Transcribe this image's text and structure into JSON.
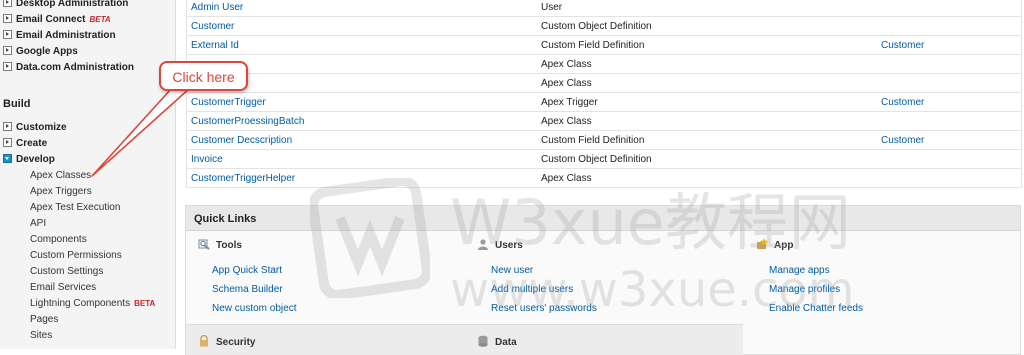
{
  "sidebar": {
    "admin_items": [
      {
        "label": "Desktop Administration",
        "beta": ""
      },
      {
        "label": "Email Connect",
        "beta": "BETA"
      },
      {
        "label": "Email Administration",
        "beta": ""
      },
      {
        "label": "Google Apps",
        "beta": ""
      },
      {
        "label": "Data.com Administration",
        "beta": ""
      }
    ],
    "build_heading": "Build",
    "build_items": [
      {
        "label": "Customize"
      },
      {
        "label": "Create"
      },
      {
        "label": "Develop"
      }
    ],
    "develop_items": [
      {
        "label": "Apex Classes",
        "beta": ""
      },
      {
        "label": "Apex Triggers",
        "beta": ""
      },
      {
        "label": "Apex Test Execution",
        "beta": ""
      },
      {
        "label": "API",
        "beta": ""
      },
      {
        "label": "Components",
        "beta": ""
      },
      {
        "label": "Custom Permissions",
        "beta": ""
      },
      {
        "label": "Custom Settings",
        "beta": ""
      },
      {
        "label": "Email Services",
        "beta": ""
      },
      {
        "label": "Lightning Components",
        "beta": "BETA"
      },
      {
        "label": "Pages",
        "beta": ""
      },
      {
        "label": "Sites",
        "beta": ""
      }
    ]
  },
  "results": [
    {
      "name": "Admin User",
      "type": "User",
      "object": ""
    },
    {
      "name": "Customer",
      "type": "Custom Object Definition",
      "object": ""
    },
    {
      "name": "External Id",
      "type": "Custom Field Definition",
      "object": "Customer"
    },
    {
      "name": "",
      "type": "Apex Class",
      "object": ""
    },
    {
      "name": "",
      "type": "Apex Class",
      "object": ""
    },
    {
      "name": "CustomerTrigger",
      "type": "Apex Trigger",
      "object": "Customer"
    },
    {
      "name": "CustomerProessingBatch",
      "type": "Apex Class",
      "object": ""
    },
    {
      "name": "Customer Decscription",
      "type": "Custom Field Definition",
      "object": "Customer"
    },
    {
      "name": "Invoice",
      "type": "Custom Object Definition",
      "object": ""
    },
    {
      "name": "CustomerTriggerHelper",
      "type": "Apex Class",
      "object": ""
    }
  ],
  "callout": {
    "text": "Click here"
  },
  "quick_links": {
    "title": "Quick Links",
    "tools": {
      "heading": "Tools",
      "icon": "tools-icon",
      "links": [
        "App Quick Start",
        "Schema Builder",
        "New custom object"
      ]
    },
    "users": {
      "heading": "Users",
      "icon": "user-icon",
      "links": [
        "New user",
        "Add multiple users",
        "Reset users' passwords"
      ]
    },
    "app": {
      "heading": "App",
      "icon": "app-icon",
      "links": [
        "Manage apps",
        "Manage profiles",
        "Enable Chatter feeds"
      ]
    },
    "security": {
      "heading": "Security",
      "icon": "lock-icon"
    },
    "data": {
      "heading": "Data",
      "icon": "database-icon"
    }
  },
  "watermark": {
    "line1": "W3xue教程网",
    "line2": "www.w3xue.com"
  },
  "colors": {
    "link": "#015ba7",
    "beta": "#c0272d",
    "callout": "#d9473d"
  }
}
